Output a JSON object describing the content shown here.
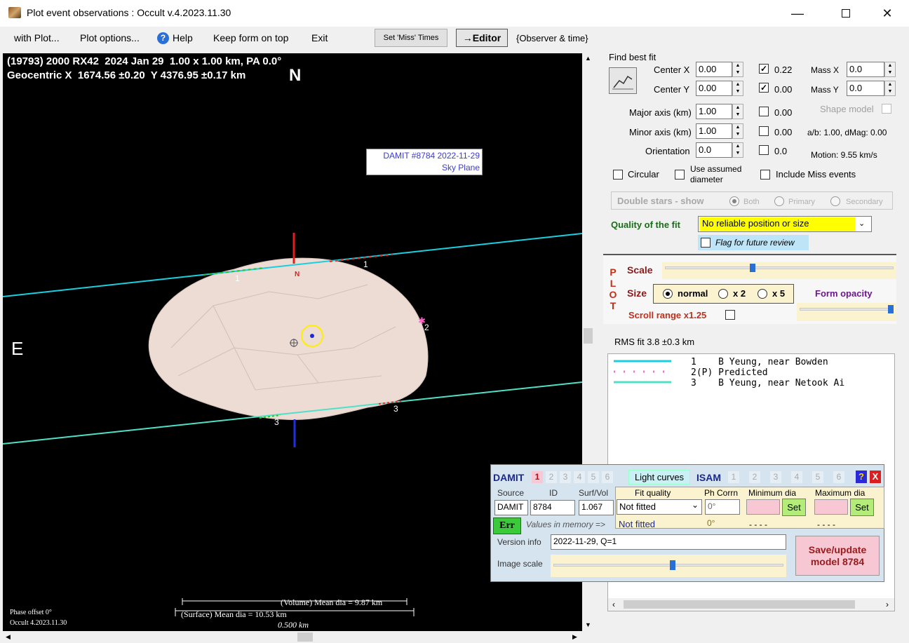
{
  "window": {
    "title": "Plot event observations : Occult v.4.2023.11.30"
  },
  "menu": {
    "items": [
      "with Plot...",
      "Plot options...",
      "Help",
      "Keep form on top",
      "Exit"
    ],
    "set_miss_times": "Set 'Miss' Times",
    "editor": "→Editor",
    "observer_time": "{Observer & time}"
  },
  "plot": {
    "header_line1": "(19793) 2000 RX42  2024 Jan 29  1.00 x 1.00 km, PA 0.0°",
    "header_line2": "Geocentric X  1674.56 ±0.20  Y 4376.95 ±0.17 km",
    "north_label": "N",
    "east_label": "E",
    "damit_label_line1": "DAMIT #8784 2022-11-29",
    "damit_label_line2": "Sky Plane",
    "pole_n": "N",
    "chord_labels": [
      "1",
      "1",
      "2",
      "3",
      "3"
    ],
    "volume_mean": "(Volume) Mean dia = 9.87 km",
    "surface_mean": "(Surface) Mean dia = 10.53 km",
    "scale_bar": "0.500 km",
    "phase_offset": "Phase offset 0°",
    "version": "Occult 4.2023.11.30",
    "colors": {
      "chord_cyan": "#1ad0e0",
      "chord_mint": "#50e0c8",
      "shape_fill": "#ecdcd4"
    }
  },
  "fit": {
    "find_best_fit": "Find best fit",
    "center_x": {
      "label": "Center X",
      "value": "0.00",
      "checked": true,
      "result": "0.22"
    },
    "center_y": {
      "label": "Center Y",
      "value": "0.00",
      "checked": true,
      "result": "0.00"
    },
    "major_axis": {
      "label": "Major axis (km)",
      "value": "1.00",
      "checked": false,
      "result": "0.00"
    },
    "minor_axis": {
      "label": "Minor axis (km)",
      "value": "1.00",
      "checked": false,
      "result": "0.00"
    },
    "orientation": {
      "label": "Orientation",
      "value": "0.0",
      "checked": false,
      "result": "0.0"
    },
    "mass_x": {
      "label": "Mass X",
      "value": "0.0"
    },
    "mass_y": {
      "label": "Mass Y",
      "value": "0.0"
    },
    "shape_model": "Shape model",
    "ab_dmag": "a/b: 1.00, dMag: 0.00",
    "motion": "Motion: 9.55 km/s",
    "circular": "Circular",
    "use_assumed_line1": "Use assumed",
    "use_assumed_line2": "diameter",
    "include_miss": "Include Miss events"
  },
  "double_stars": {
    "label": "Double stars - show",
    "both": "Both",
    "primary": "Primary",
    "secondary": "Secondary"
  },
  "quality": {
    "label": "Quality of the fit",
    "value": "No reliable position or size",
    "flag_review": "Flag for future review"
  },
  "plot_ctrl": {
    "side_letters": [
      "P",
      "L",
      "O",
      "T"
    ],
    "scale": "Scale",
    "scale_fraction": 0.38,
    "size": "Size",
    "size_options": [
      "normal",
      "x 2",
      "x 5"
    ],
    "form_opacity": "Form opacity",
    "opacity_fraction": 1.0,
    "scroll_range": "Scroll range x1.25"
  },
  "rms": "RMS fit 3.8 ±0.3 km",
  "legend": [
    {
      "line": "1    B Yeung, near Bowden"
    },
    {
      "line": "2(P) Predicted"
    },
    {
      "line": "3    B Yeung, near Netook Ai"
    }
  ],
  "damit": {
    "title": "DAMIT",
    "tabs": [
      "1",
      "2",
      "3",
      "4",
      "5",
      "6"
    ],
    "light_curves": "Light curves",
    "isam": "ISAM",
    "isam_tabs": [
      "1",
      "2",
      "3",
      "4",
      "5",
      "6"
    ],
    "help": "?",
    "close": "X",
    "source_label": "Source",
    "id_label": "ID",
    "surfvol_label": "Surf/Vol",
    "source": "DAMIT",
    "id": "8784",
    "surfvol": "1.067",
    "fit_quality_label": "Fit quality",
    "fit_quality": "Not fitted",
    "ph_corrn_label": "Ph Corrn",
    "ph_corrn": "0°",
    "min_dia_label": "Minimum dia",
    "max_dia_label": "Maximum dia",
    "set": "Set",
    "err": "Err",
    "values_memory": "Values in memory =>",
    "mem_fit": "Not fitted",
    "mem_ph": "0°",
    "mem_min": "- - - -",
    "mem_max": "- - - -",
    "version_info_label": "Version info",
    "version_info": "2022-11-29, Q=1",
    "image_scale_label": "Image scale",
    "image_scale_fraction": 0.52,
    "save_line1": "Save/update",
    "save_line2": "model 8784"
  }
}
